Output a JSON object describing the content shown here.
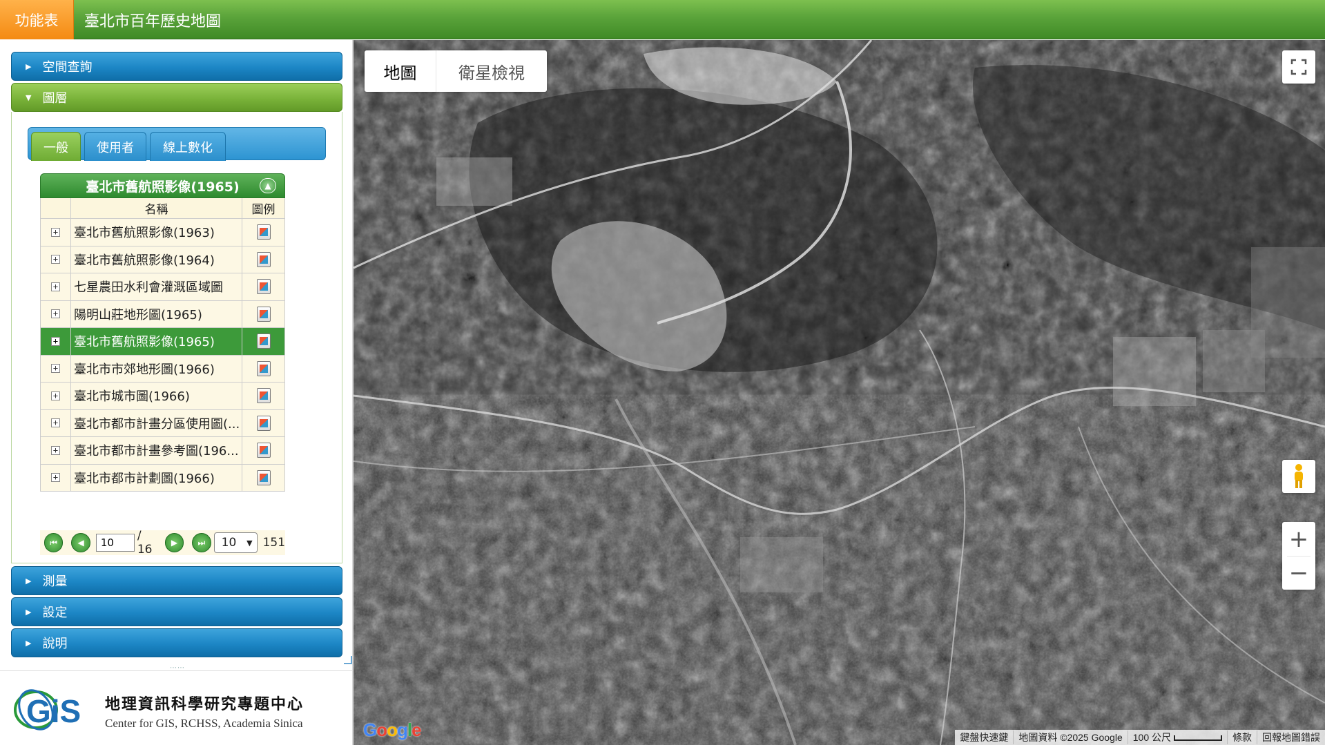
{
  "topbar": {
    "menu_label": "功能表",
    "title": "臺北市百年歷史地圖"
  },
  "accordion": {
    "spatial_query": "空間查詢",
    "layers": "圖層",
    "measure": "測量",
    "settings": "設定",
    "help": "說明"
  },
  "tabs": {
    "general": "一般",
    "user": "使用者",
    "digitize": "線上數化"
  },
  "layer_grid": {
    "title": "臺北市舊航照影像(1965)",
    "col_name": "名稱",
    "col_legend": "圖例",
    "rows": [
      {
        "name": "臺北市舊航照影像(1963)",
        "selected": false
      },
      {
        "name": "臺北市舊航照影像(1964)",
        "selected": false
      },
      {
        "name": "七星農田水利會灌溉區域圖",
        "selected": false
      },
      {
        "name": "陽明山莊地形圖(1965)",
        "selected": false
      },
      {
        "name": "臺北市舊航照影像(1965)",
        "selected": true
      },
      {
        "name": "臺北市市郊地形圖(1966)",
        "selected": false
      },
      {
        "name": "臺北市城市圖(1966)",
        "selected": false
      },
      {
        "name": "臺北市都市計畫分區使用圖(...",
        "selected": false
      },
      {
        "name": "臺北市都市計畫參考圖(196...",
        "selected": false
      },
      {
        "name": "臺北市都市計劃圖(1966)",
        "selected": false
      }
    ]
  },
  "pager": {
    "current_page": "10",
    "total_pages": "/ 16",
    "page_size": "10",
    "total_records": "151"
  },
  "footer": {
    "center_name_cn": "地理資訊科學研究專題中心",
    "center_name_en": "Center for GIS, RCHSS, Academia Sinica",
    "logo_text": "GIS"
  },
  "map": {
    "type_map": "地圖",
    "type_satellite": "衛星檢視",
    "attribution": {
      "shortcuts": "鍵盤快速鍵",
      "data": "地圖資料 ©2025 Google",
      "scale": "100 公尺",
      "terms": "條款",
      "report": "回報地圖錯誤"
    },
    "google_logo": "Google"
  },
  "colors": {
    "topbar_green": "#5aa33a",
    "menu_orange": "#f48a12",
    "accordion_blue": "#1c86c5",
    "selected_row": "#3d9a3a"
  }
}
